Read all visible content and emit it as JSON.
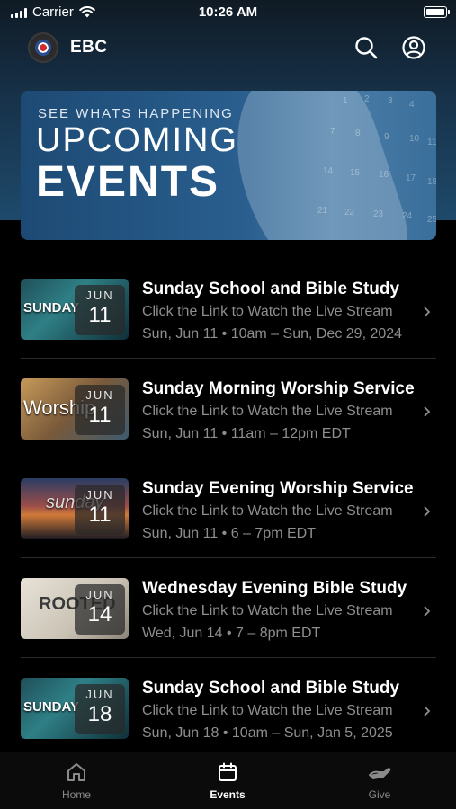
{
  "status_bar": {
    "carrier": "Carrier",
    "time": "10:26 AM"
  },
  "header": {
    "title": "EBC",
    "icons": [
      "church-logo",
      "search-icon",
      "account-icon"
    ]
  },
  "banner": {
    "kicker": "SEE WHATS HAPPENING",
    "title_line1": "UPCOMING",
    "title_line2": "EVENTS"
  },
  "events": [
    {
      "thumb_text": "SUNDAY",
      "month": "JUN",
      "day": "11",
      "title": "Sunday School and Bible Study",
      "subtitle": "Click the Link to Watch the Live Stream",
      "time": "Sun, Jun 11 • 10am – Sun, Dec 29, 2024"
    },
    {
      "thumb_text": "Worship",
      "month": "JUN",
      "day": "11",
      "title": "Sunday Morning Worship Service",
      "subtitle": "Click the Link to Watch the Live Stream",
      "time": "Sun, Jun 11 • 11am – 12pm EDT"
    },
    {
      "thumb_text": "sunday",
      "month": "JUN",
      "day": "11",
      "title": "Sunday Evening Worship Service",
      "subtitle": "Click the Link to Watch the Live Stream",
      "time": "Sun, Jun 11 • 6 – 7pm EDT"
    },
    {
      "thumb_text": "ROOTED",
      "month": "JUN",
      "day": "14",
      "title": "Wednesday Evening Bible Study",
      "subtitle": "Click the Link to Watch the Live Stream",
      "time": "Wed, Jun 14 • 7 – 8pm EDT"
    },
    {
      "thumb_text": "SUNDAY",
      "month": "JUN",
      "day": "18",
      "title": "Sunday School and Bible Study",
      "subtitle": "Click the Link to Watch the Live Stream",
      "time": "Sun, Jun 18 • 10am – Sun, Jan 5, 2025"
    }
  ],
  "tabs": [
    {
      "label": "Home",
      "icon": "home-icon",
      "active": false
    },
    {
      "label": "Events",
      "icon": "calendar-icon",
      "active": true
    },
    {
      "label": "Give",
      "icon": "give-icon",
      "active": false
    }
  ],
  "colors": {
    "background": "#000000",
    "header_gradient_top": "#0f1a24",
    "header_gradient_bottom": "#1e4a6b",
    "banner_blue": "#2a5f8f",
    "secondary_text": "#8e8e8e",
    "tab_inactive": "#8a8a8a"
  }
}
